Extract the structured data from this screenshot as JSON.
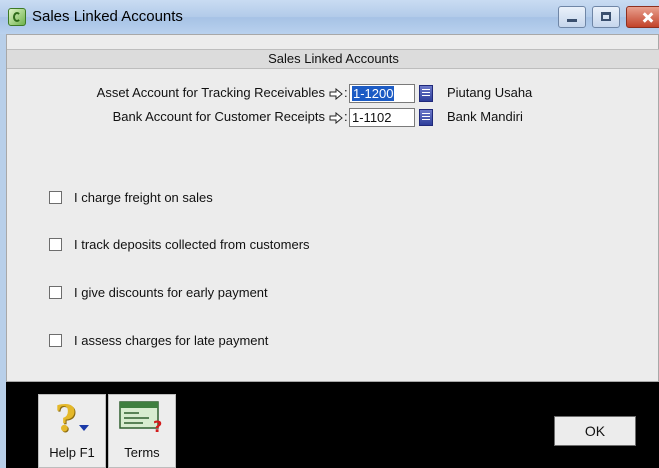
{
  "window": {
    "title": "Sales Linked Accounts"
  },
  "dialog": {
    "header": "Sales Linked Accounts",
    "fields": [
      {
        "label": "Asset Account for Tracking Receivables",
        "account": "1-1200",
        "account_name": "Piutang Usaha"
      },
      {
        "label": "Bank Account for Customer Receipts",
        "account": "1-1102",
        "account_name": "Bank Mandiri"
      }
    ],
    "arrow_suffix": ":",
    "options": [
      {
        "label": "I charge freight on sales",
        "checked": false
      },
      {
        "label": "I track deposits collected from customers",
        "checked": false
      },
      {
        "label": "I give discounts for early payment",
        "checked": false
      },
      {
        "label": "I assess charges for late payment",
        "checked": false
      }
    ]
  },
  "toolbar": {
    "help_label": "Help F1",
    "terms_label": "Terms",
    "ok_label": "OK"
  },
  "colors": {
    "selection": "#1c5bc4",
    "list_button": "#2e3e9a",
    "title_bar": "#b2cbe9"
  }
}
